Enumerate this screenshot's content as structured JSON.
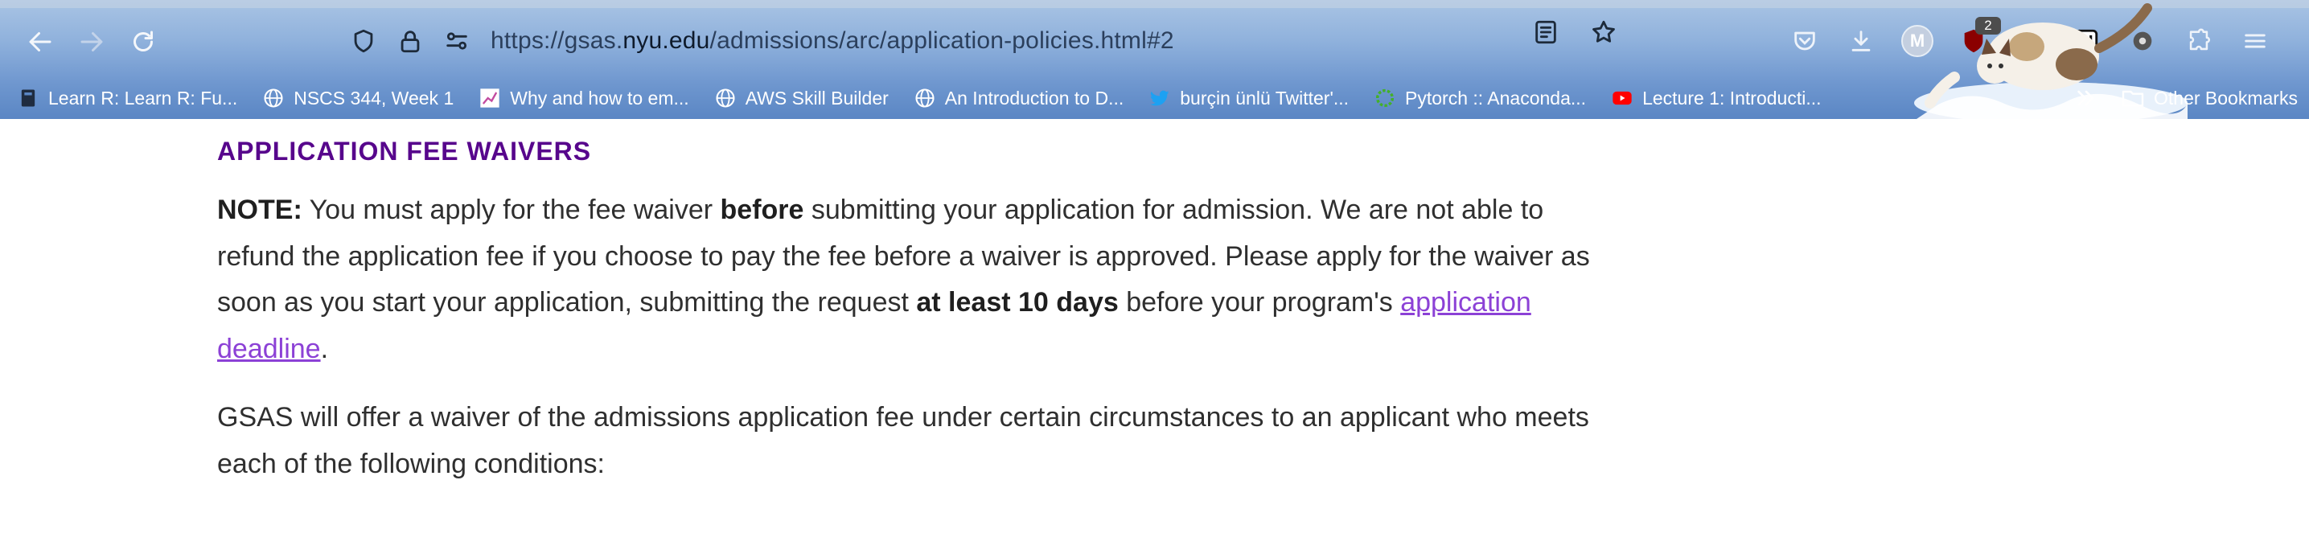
{
  "browser": {
    "url_prefix": "https://gsas.",
    "url_host": "nyu.edu",
    "url_suffix": "/admissions/arc/application-policies.html#2",
    "extension_badge": "2",
    "account_initial": "M"
  },
  "bookmarks": [
    {
      "label": "Learn R: Learn R: Fu...",
      "icon": "book-icon"
    },
    {
      "label": "NSCS 344, Week 1",
      "icon": "globe-icon"
    },
    {
      "label": "Why and how to em...",
      "icon": "chart-icon"
    },
    {
      "label": "AWS Skill Builder",
      "icon": "globe-icon"
    },
    {
      "label": "An Introduction to D...",
      "icon": "globe-icon"
    },
    {
      "label": "burçin ünlü Twitter'...",
      "icon": "twitter-icon"
    },
    {
      "label": "Pytorch :: Anaconda...",
      "icon": "anaconda-icon"
    },
    {
      "label": "Lecture 1: Introducti...",
      "icon": "youtube-icon"
    }
  ],
  "other_bookmarks": "Other Bookmarks",
  "content": {
    "heading": "APPLICATION FEE WAIVERS",
    "p1": {
      "note": "NOTE:",
      "t1": " You must apply for the fee waiver ",
      "before": "before",
      "t2": " submitting your application for admission. We are not able to refund the application fee if you choose to pay the fee before a waiver is approved. Please apply for the waiver as soon as you start your application, submitting the request ",
      "bold2": "at least 10 days",
      "t3": " before your program's ",
      "link": "application deadline",
      "t4": "."
    },
    "p2": "GSAS will offer a waiver of the admissions application fee under certain circumstances to an applicant who meets each of the following conditions:"
  },
  "colors": {
    "heading": "#57068c",
    "link": "#8c41d6",
    "body_text": "#2f2f2f"
  }
}
